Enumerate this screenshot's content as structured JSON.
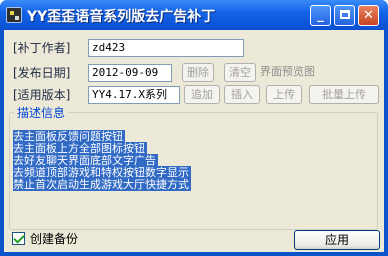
{
  "window": {
    "title": "YY歪歪语音系列版去广告补丁",
    "minimize_glyph": "_",
    "close_glyph": "✕"
  },
  "form": {
    "author_label": "[补丁作者]",
    "author_value": "zd423",
    "date_label": "[发布日期]",
    "date_value": "2012-09-09",
    "version_label": "[适用版本]",
    "version_value": "YY4.17.X系列"
  },
  "buttons": {
    "delete": "删除",
    "clear": "清空",
    "add": "追加",
    "insert": "插入",
    "upload": "上传",
    "batch_upload": "批量上传",
    "apply": "应用"
  },
  "preview_label": "界面预览图",
  "description": {
    "title": "描述信息",
    "lines": [
      "去主面板反馈问题按钮",
      "去主面板上方全部图标按钮",
      "去好友聊天界面底部文字广告",
      "去频道顶部游戏和特权按钮数字显示",
      "禁止首次启动生成游戏大厅快捷方式"
    ]
  },
  "backup": {
    "label": "创建备份",
    "checked": true
  },
  "colors": {
    "titlebar": "#1464e8",
    "selection": "#316ac5",
    "client_bg": "#ece9d8",
    "group_title": "#0046d5"
  }
}
